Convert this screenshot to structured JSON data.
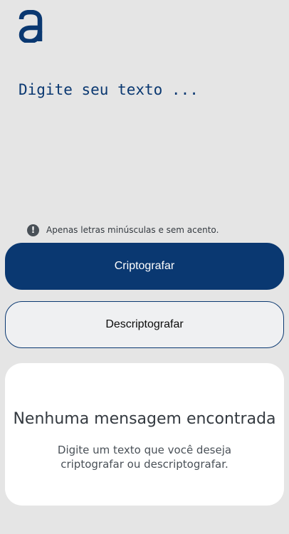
{
  "app": {
    "logo_icon": "alura-a-logo-icon",
    "brand_color": "#0a3871"
  },
  "input": {
    "placeholder": "Digite seu texto ...",
    "value": ""
  },
  "hint": {
    "icon": "exclamation-circle-icon",
    "text": "Apenas letras minúsculas e sem acento."
  },
  "actions": {
    "encrypt_label": "Criptografar",
    "decrypt_label": "Descriptografar"
  },
  "output": {
    "title": "Nenhuma mensagem encontrada",
    "description": "Digite um texto que você deseja criptografar ou descriptografar."
  }
}
